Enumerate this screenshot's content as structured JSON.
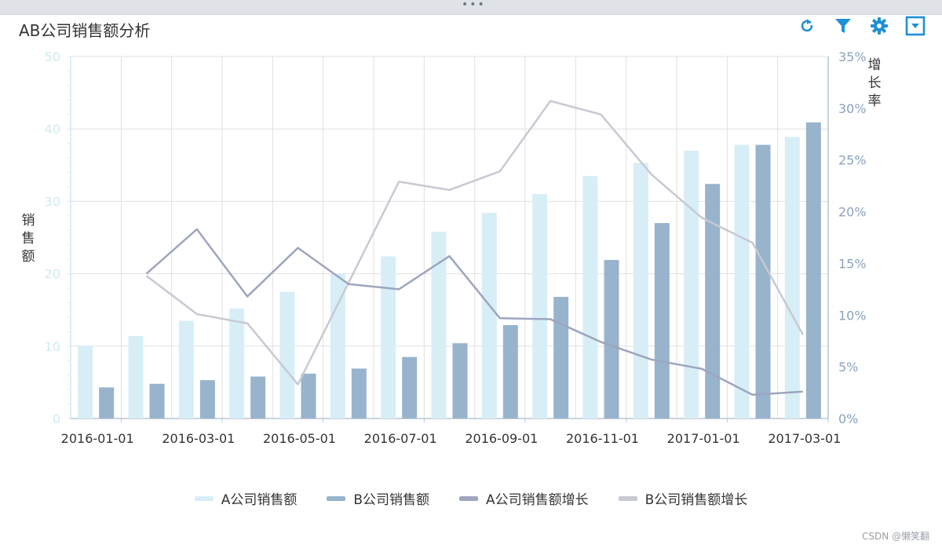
{
  "window": {
    "handle_label": "•••"
  },
  "title": "AB公司销售额分析",
  "toolbar": {
    "icons": [
      "refresh-icon",
      "filter-icon",
      "gear-icon",
      "dropdown-icon"
    ]
  },
  "watermark": "CSDN @懒笑翻",
  "colors": {
    "a_sales": "#d7eef6",
    "b_sales": "#98b3cc",
    "a_growth": "#9ea5be",
    "b_growth": "#c7c9d3",
    "accent": "#1e90d6",
    "grid": "#e0e0e0",
    "left_axis_text": "#cfeaf2",
    "right_axis_text": "#8aa2bd"
  },
  "chart_data": {
    "type": "bar",
    "title": "AB公司销售额分析",
    "categories": [
      "2016-01-01",
      "2016-02-01",
      "2016-03-01",
      "2016-04-01",
      "2016-05-01",
      "2016-06-01",
      "2016-07-01",
      "2016-08-01",
      "2016-09-01",
      "2016-10-01",
      "2016-11-01",
      "2016-12-01",
      "2017-01-01",
      "2017-02-01",
      "2017-03-01"
    ],
    "x_tick_labels": [
      "2016-01-01",
      "2016-03-01",
      "2016-05-01",
      "2016-07-01",
      "2016-09-01",
      "2016-11-01",
      "2017-01-01",
      "2017-03-01"
    ],
    "ylabel": "销售额",
    "ylabel_right": "增长率",
    "ylim": [
      0,
      50
    ],
    "y_ticks": [
      0,
      10,
      20,
      30,
      40,
      50
    ],
    "ylim_right": [
      0,
      35
    ],
    "y_right_ticks": [
      "0%",
      "5%",
      "10%",
      "15%",
      "20%",
      "25%",
      "30%",
      "35%"
    ],
    "grid": true,
    "legend_position": "bottom",
    "series": [
      {
        "name": "A公司销售额",
        "kind": "bar",
        "axis": "left",
        "values": [
          10.0,
          11.4,
          13.5,
          15.2,
          17.5,
          20.0,
          22.4,
          25.8,
          28.4,
          31.0,
          33.5,
          35.3,
          37.0,
          37.8,
          38.9
        ]
      },
      {
        "name": "B公司销售额",
        "kind": "bar",
        "axis": "left",
        "values": [
          4.3,
          4.8,
          5.3,
          5.8,
          6.2,
          6.9,
          8.5,
          10.4,
          12.9,
          16.8,
          21.9,
          27.0,
          32.4,
          37.8,
          40.9
        ]
      },
      {
        "name": "A公司销售额增长",
        "kind": "line",
        "axis": "right",
        "values": [
          null,
          14.0,
          18.3,
          11.8,
          16.5,
          13.0,
          12.5,
          15.7,
          9.7,
          9.6,
          7.4,
          5.7,
          4.8,
          2.3,
          2.6
        ]
      },
      {
        "name": "B公司销售额增长",
        "kind": "line",
        "axis": "right",
        "values": [
          null,
          13.8,
          10.1,
          9.2,
          3.3,
          13.1,
          22.9,
          22.1,
          23.9,
          30.7,
          29.4,
          23.6,
          19.4,
          17.0,
          8.1
        ]
      }
    ]
  }
}
